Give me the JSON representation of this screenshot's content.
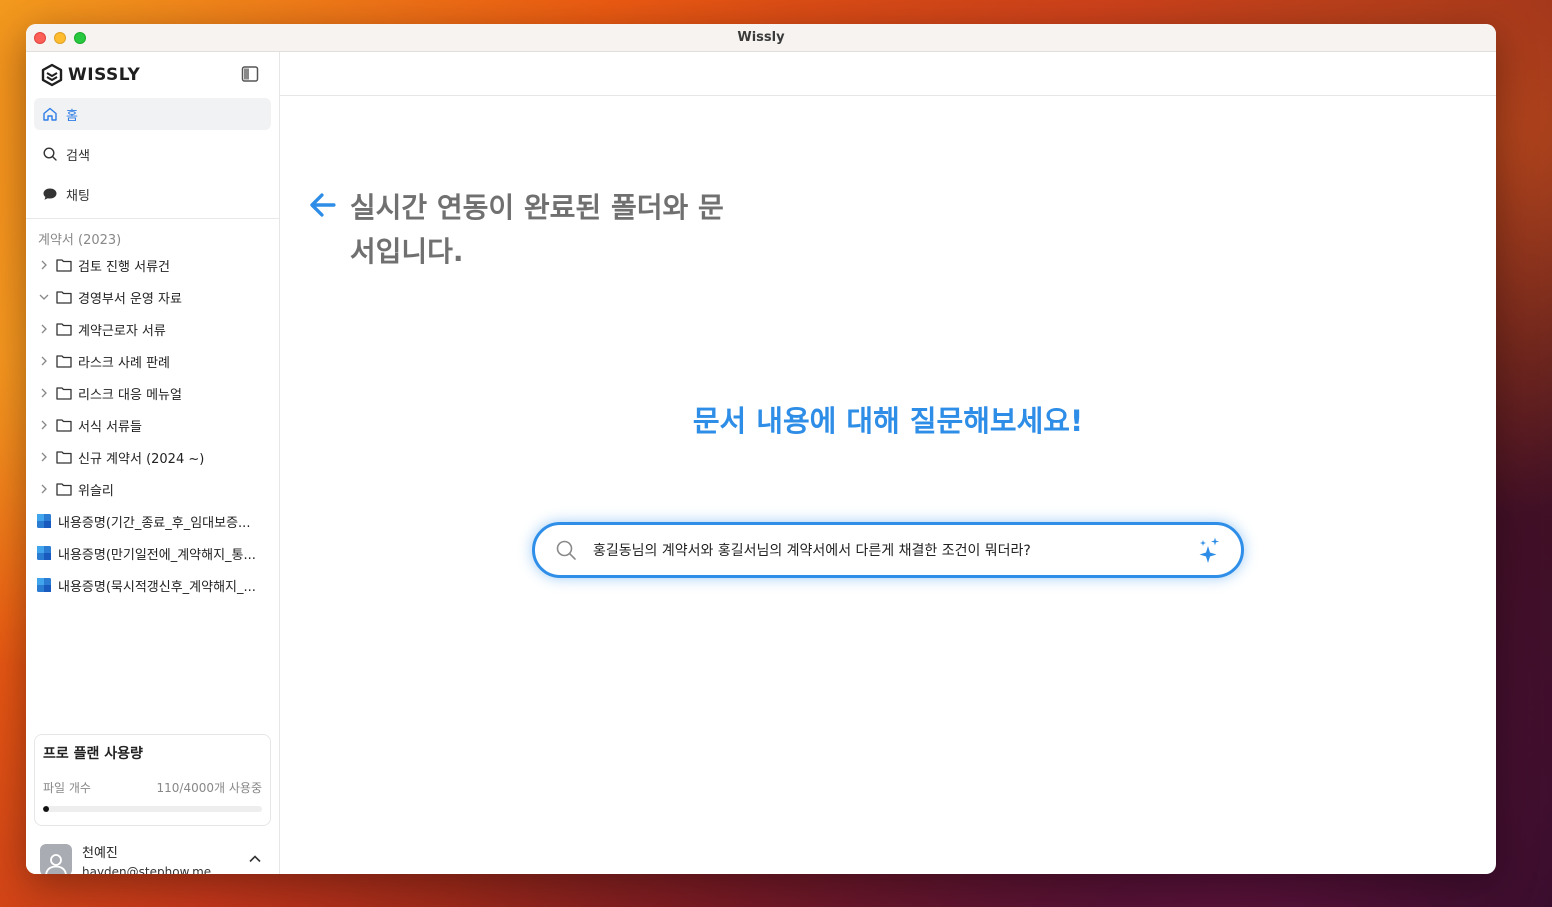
{
  "window": {
    "title": "Wissly"
  },
  "brand": {
    "name": "WISSLY"
  },
  "nav": [
    {
      "label": "홈",
      "icon": "home-icon",
      "active": true
    },
    {
      "label": "검색",
      "icon": "search-icon",
      "active": false
    },
    {
      "label": "채팅",
      "icon": "chat-icon",
      "active": false
    }
  ],
  "section": {
    "label": "계약서 (2023)"
  },
  "folders": [
    {
      "label": "검토 진행 서류건",
      "expanded": false
    },
    {
      "label": "경영부서 운영 자료",
      "expanded": true
    },
    {
      "label": "계약근로자 서류",
      "expanded": false
    },
    {
      "label": "라스크 사례 판례",
      "expanded": false
    },
    {
      "label": "리스크 대응 메뉴얼",
      "expanded": false
    },
    {
      "label": "서식 서류들",
      "expanded": false
    },
    {
      "label": "신규 계약서 (2024 ~)",
      "expanded": false
    },
    {
      "label": "위슬리",
      "expanded": false
    }
  ],
  "files": [
    {
      "label": "내용증명(기간_종료_후_임대보증..."
    },
    {
      "label": "내용증명(만기일전에_계약해지_통..."
    },
    {
      "label": "내용증명(묵시적갱신후_계약해지_..."
    }
  ],
  "usage": {
    "title": "프로 플랜 사용량",
    "file_count_label": "파일 개수",
    "file_count_value": "110/4000개 사용중",
    "used": 110,
    "limit": 4000
  },
  "user": {
    "name": "천예진",
    "email": "hayden@stephow.me"
  },
  "main": {
    "hint": "실시간 연동이 완료된 폴더와 문서입니다.",
    "prompt_title": "문서 내용에 대해 질문해보세요!",
    "search_value": "홍길동님의 계약서와 홍길서님의 계약서에서 다른게 채결한 조건이 뭐더라?"
  },
  "colors": {
    "accent": "#2e8de6",
    "active_nav": "#2e7ee6"
  }
}
